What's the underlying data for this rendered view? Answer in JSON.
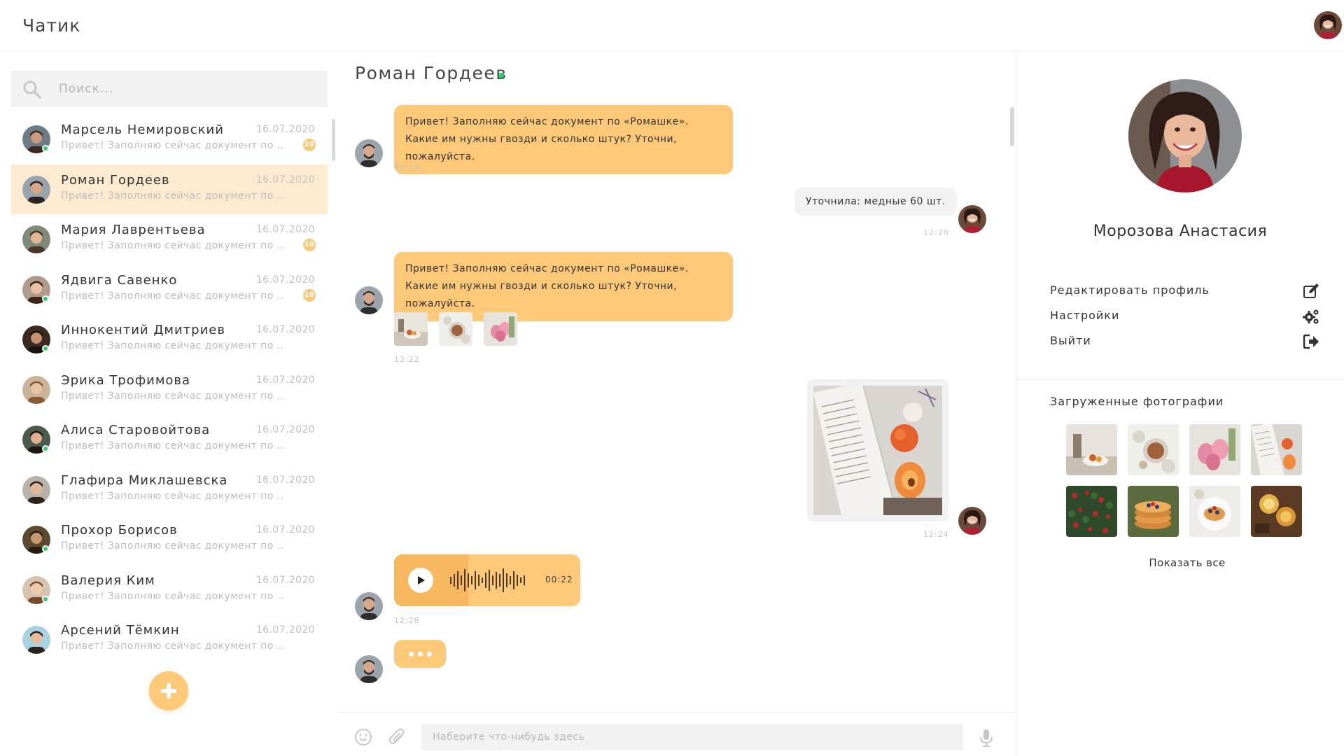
{
  "app": {
    "title": "Чатик"
  },
  "search": {
    "placeholder": "Поиск..."
  },
  "contacts": [
    {
      "name": "Марсель Немировский",
      "preview": "Привет! Заполняю сейчас документ по ....",
      "date": "16.07.2020",
      "badge": "10",
      "online": true
    },
    {
      "name": "Роман Гордеев",
      "preview": "Привет! Заполняю сейчас документ по ....",
      "date": "16.07.2020",
      "badge": "",
      "online": false,
      "active": true
    },
    {
      "name": "Мария Лаврентьева",
      "preview": "Привет! Заполняю сейчас документ по ....",
      "date": "16.07.2020",
      "badge": "10",
      "online": false
    },
    {
      "name": "Ядвига Савенко",
      "preview": "Привет! Заполняю сейчас документ по ....",
      "date": "16.07.2020",
      "badge": "10",
      "online": true
    },
    {
      "name": "Иннокентий Дмитриев",
      "preview": "Привет! Заполняю сейчас документ по ....",
      "date": "16.07.2020",
      "badge": "",
      "online": true
    },
    {
      "name": "Эрика Трофимова",
      "preview": "Привет! Заполняю сейчас документ по ....",
      "date": "16.07.2020",
      "badge": "",
      "online": false
    },
    {
      "name": "Алиса Старовойтова",
      "preview": "Привет! Заполняю сейчас документ по ....",
      "date": "16.07.2020",
      "badge": "",
      "online": true
    },
    {
      "name": "Глафира Миклашевска",
      "preview": "Привет! Заполняю сейчас документ по ....",
      "date": "16.07.2020",
      "badge": "",
      "online": false
    },
    {
      "name": "Прохор Борисов",
      "preview": "Привет! Заполняю сейчас документ по ....",
      "date": "16.07.2020",
      "badge": "",
      "online": true
    },
    {
      "name": "Валерия Ким",
      "preview": "Привет! Заполняю сейчас документ по ....",
      "date": "16.07.2020",
      "badge": "",
      "online": true
    },
    {
      "name": "Арсений Тёмкин",
      "preview": "Привет! Заполняю сейчас документ по ....",
      "date": "16.07.2020",
      "badge": "",
      "online": false
    }
  ],
  "chat": {
    "title": "Роман Гордеев",
    "messages": [
      {
        "text": "Привет! Заполняю сейчас документ по «Ромашке». Какие им нужны гвозди и сколько штук? Уточни, пожалуйста.",
        "time": "12:18"
      },
      {
        "text": "Уточнила: медные 60 шт.",
        "time": "12:20"
      },
      {
        "text": "Привет! Заполняю сейчас документ по «Ромашке». Какие им нужны гвозди и сколько штук? Уточни, пожалуйста.",
        "time": "12:22"
      },
      {
        "time": "12:24"
      },
      {
        "duration": "00:22",
        "progress": 0.4,
        "time": "12:28"
      }
    ],
    "composer_placeholder": "Наберите что-нибудь здесь"
  },
  "profile": {
    "name": "Морозова Анастасия",
    "menu": [
      {
        "label": "Редактировать профиль",
        "icon": "edit-icon"
      },
      {
        "label": "Настройки",
        "icon": "gears-icon"
      },
      {
        "label": "Выйти",
        "icon": "logout-icon"
      }
    ],
    "photos_title": "Загруженные фотографии",
    "show_all": "Показать все"
  },
  "colors": {
    "accent": "#fdc877",
    "active_row": "#fdebd1",
    "online": "#2ecc71",
    "outgoing_bubble": "#f2f2f2"
  }
}
